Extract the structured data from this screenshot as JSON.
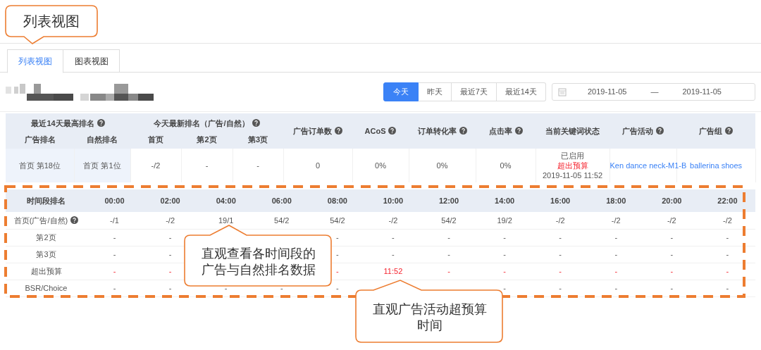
{
  "callouts": [
    {
      "text": "列表视图"
    },
    {
      "text": "直观查看各时间段的广告与自然排名数据"
    },
    {
      "text": "直观广告活动超预算时间"
    }
  ],
  "tabs": [
    {
      "label": "列表视图",
      "selected": true
    },
    {
      "label": "图表视图",
      "selected": false
    }
  ],
  "range_buttons": [
    {
      "label": "今天",
      "selected": true
    },
    {
      "label": "昨天",
      "selected": false
    },
    {
      "label": "最近7天",
      "selected": false
    },
    {
      "label": "最近14天",
      "selected": false
    }
  ],
  "date_range": {
    "start": "2019-11-05",
    "separator": "—",
    "end": "2019-11-05"
  },
  "summary_table": {
    "column_groups": [
      {
        "label": "最近14天最高排名",
        "help": true,
        "columns": [
          {
            "label": "广告排名"
          },
          {
            "label": "自然排名"
          }
        ]
      },
      {
        "label": "今天最新排名（广告/自然）",
        "help": true,
        "columns": [
          {
            "label": "首页"
          },
          {
            "label": "第2页"
          },
          {
            "label": "第3页"
          }
        ]
      }
    ],
    "columns": [
      {
        "label": "广告订单数",
        "help": true
      },
      {
        "label": "ACoS",
        "help": true
      },
      {
        "label": "订单转化率",
        "help": true
      },
      {
        "label": "点击率",
        "help": true
      },
      {
        "label": "当前关键词状态",
        "help": false
      },
      {
        "label": "广告活动",
        "help": true
      },
      {
        "label": "广告组",
        "help": true
      }
    ],
    "row": [
      {
        "kind": "plain",
        "text": "首页 第18位",
        "highlighted": true
      },
      {
        "kind": "plain",
        "text": "首页 第1位",
        "highlighted": true
      },
      {
        "kind": "plain",
        "text": "-/2",
        "highlighted": false
      },
      {
        "kind": "plain",
        "text": "-",
        "highlighted": false
      },
      {
        "kind": "plain",
        "text": "-",
        "highlighted": false
      },
      {
        "kind": "plain",
        "text": "0",
        "highlighted": false
      },
      {
        "kind": "plain",
        "text": "0%",
        "highlighted": false
      },
      {
        "kind": "plain",
        "text": "0%",
        "highlighted": false
      },
      {
        "kind": "plain",
        "text": "0%",
        "highlighted": false
      },
      {
        "kind": "status",
        "lines": [
          {
            "text": "已启用",
            "alert": false
          },
          {
            "text": "超出预算",
            "alert": true
          },
          {
            "text": "2019-11-05 11:52",
            "alert": false
          }
        ]
      },
      {
        "kind": "link",
        "text": "Ken dance neck-M1-B"
      },
      {
        "kind": "link",
        "text": "ballerina shoes"
      }
    ]
  },
  "hourly_table": {
    "corner": "时间段排名",
    "times": [
      "00:00",
      "02:00",
      "04:00",
      "06:00",
      "08:00",
      "10:00",
      "12:00",
      "14:00",
      "16:00",
      "18:00",
      "20:00",
      "22:00"
    ],
    "rows": [
      {
        "label": "首页(广告/自然)",
        "help": true,
        "alert": false,
        "cells": [
          "-/1",
          "-/2",
          "19/1",
          "54/2",
          "54/2",
          "-/2",
          "54/2",
          "19/2",
          "-/2",
          "-/2",
          "-/2",
          "-/2"
        ]
      },
      {
        "label": "第2页",
        "help": false,
        "alert": false,
        "cells": [
          "-",
          "-",
          null,
          null,
          "-",
          "-",
          "-",
          "-",
          "-",
          "-",
          "-",
          "-"
        ]
      },
      {
        "label": "第3页",
        "help": false,
        "alert": false,
        "cells": [
          "-",
          "-",
          null,
          null,
          "-",
          "-",
          "-",
          "-",
          "-",
          "-",
          "-",
          "-"
        ]
      },
      {
        "label": "超出预算",
        "help": false,
        "alert": true,
        "cells": [
          "-",
          "-",
          null,
          null,
          "-",
          "11:52",
          "-",
          "-",
          "-",
          "-",
          "-",
          "-"
        ]
      },
      {
        "label": "BSR/Choice",
        "help": false,
        "alert": false,
        "cells": [
          "-",
          "-",
          "-",
          "-",
          "-",
          null,
          null,
          "-",
          "-",
          "-",
          "-",
          "-"
        ]
      }
    ]
  }
}
